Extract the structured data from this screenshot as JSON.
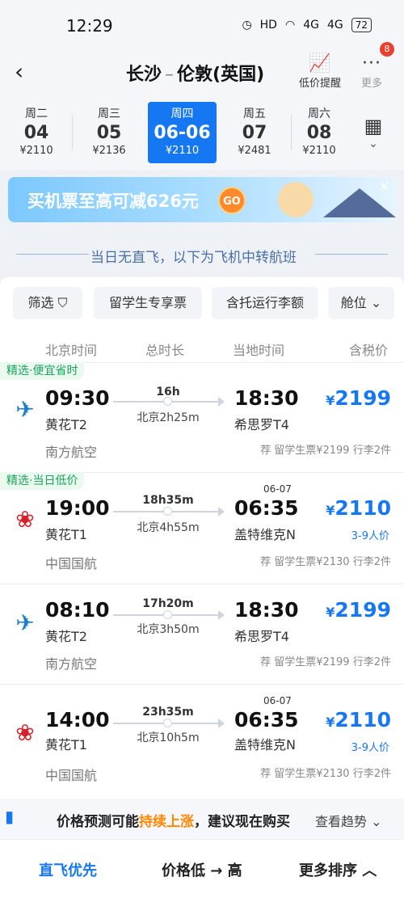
{
  "status_bar": {
    "time": "12:29",
    "battery": "72",
    "net1": "4G",
    "net2": "4G",
    "hd": "HD"
  },
  "header": {
    "origin": "长沙",
    "dash": "–",
    "destination": "伦敦(英国)",
    "price_alert": "低价提醒",
    "more": "更多",
    "badge": "8"
  },
  "dates": [
    {
      "dow": "周二",
      "day": "04",
      "price": "¥2110",
      "selected": false
    },
    {
      "dow": "周三",
      "day": "05",
      "price": "¥2136",
      "selected": false
    },
    {
      "dow": "周四",
      "day": "06-06",
      "price": "¥2110",
      "selected": true
    },
    {
      "dow": "周五",
      "day": "07",
      "price": "¥2481",
      "selected": false
    },
    {
      "dow": "周六",
      "day": "08",
      "price": "¥2110",
      "selected": false
    }
  ],
  "promo": {
    "text": "买机票至高可减626元",
    "go": "GO"
  },
  "notice": "当日无直飞，以下为飞机中转航班",
  "filters": [
    "筛选",
    "留学生专享票",
    "含托运行李额",
    "舱位"
  ],
  "columns": {
    "depart": "北京时间",
    "duration": "总时长",
    "arrive": "当地时间",
    "price": "含税价"
  },
  "flights": [
    {
      "tag": "精选·便宜省时",
      "dep_time": "09:30",
      "dep_airport": "黄花T2",
      "duration": "16h",
      "stop": "北京2h25m",
      "arr_time": "18:30",
      "arr_airport": "希思罗T4",
      "next_day": "",
      "price": "2199",
      "pax": "",
      "airline": "南方航空",
      "rec": "荐 留学生票¥2199 行李2件"
    },
    {
      "tag": "精选·当日低价",
      "dep_time": "19:00",
      "dep_airport": "黄花T1",
      "duration": "18h35m",
      "stop": "北京4h55m",
      "arr_time": "06:35",
      "arr_airport": "盖特维克N",
      "next_day": "06-07",
      "price": "2110",
      "pax": "3-9人价",
      "airline": "中国国航",
      "rec": "荐 留学生票¥2130 行李2件"
    },
    {
      "tag": "",
      "dep_time": "08:10",
      "dep_airport": "黄花T2",
      "duration": "17h20m",
      "stop": "北京3h50m",
      "arr_time": "18:30",
      "arr_airport": "希思罗T4",
      "next_day": "",
      "price": "2199",
      "pax": "",
      "airline": "南方航空",
      "rec": "荐 留学生票¥2199 行李2件"
    },
    {
      "tag": "",
      "dep_time": "14:00",
      "dep_airport": "黄花T1",
      "duration": "23h35m",
      "stop": "北京10h5m",
      "arr_time": "06:35",
      "arr_airport": "盖特维克N",
      "next_day": "06-07",
      "price": "2110",
      "pax": "3-9人价",
      "airline": "中国国航",
      "rec": "荐 留学生票¥2130 行李2件"
    }
  ],
  "currency": "¥",
  "prediction": {
    "prefix": "价格预测可能",
    "highlight": "持续上涨",
    "suffix": "，建议现在购买",
    "trend": "查看趋势"
  },
  "bottom": {
    "direct_first": "直飞优先",
    "price_sort": "价格低 → 高",
    "more_sort": "更多排序"
  }
}
